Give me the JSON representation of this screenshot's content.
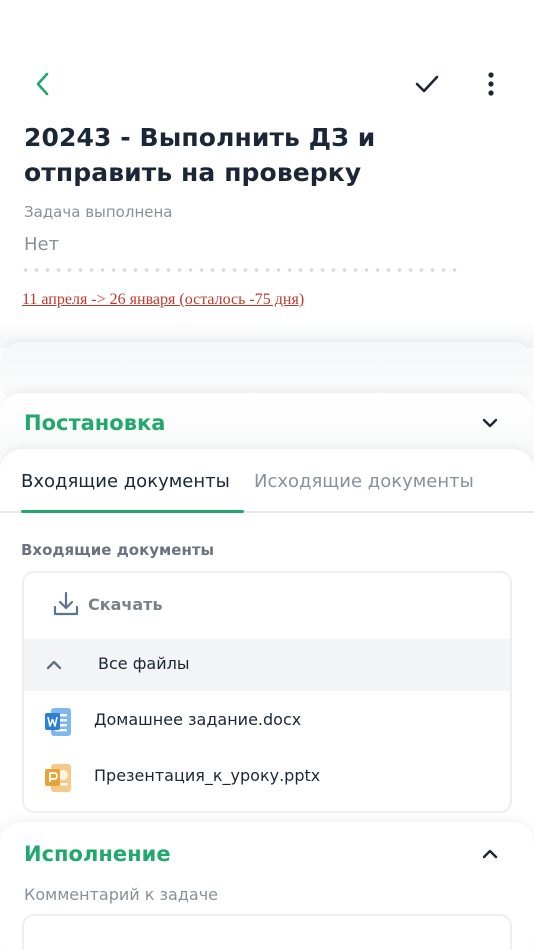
{
  "header": {
    "back_icon": "chevron-left-icon",
    "check_icon": "checkmark-icon",
    "more_icon": "vertical-dots-icon",
    "accent_color": "#21a86d"
  },
  "task": {
    "title": "20243 - Выполнить ДЗ и отправить на проверку",
    "done_label": "Задача выполнена",
    "done_value": "Нет",
    "deadline": "11 апреля -> 26 января (осталось -75 дня)",
    "deadline_color": "#c0392b"
  },
  "sections": {
    "postanovka": {
      "title": "Постановка",
      "expanded": false
    },
    "ispolnenie": {
      "title": "Исполнение",
      "expanded": true,
      "comment_label": "Комментарий к задаче"
    }
  },
  "tabs": [
    {
      "label": "Входящие документы",
      "active": true
    },
    {
      "label": "Исходящие документы",
      "active": false
    }
  ],
  "documents": {
    "label": "Входящие документы",
    "download_label": "Скачать",
    "all_files_label": "Все файлы",
    "files": [
      {
        "name": "Домашнее задание.docx",
        "icon": "word-doc-icon"
      },
      {
        "name": "Презентация_к_уроку.pptx",
        "icon": "powerpoint-icon"
      }
    ]
  }
}
